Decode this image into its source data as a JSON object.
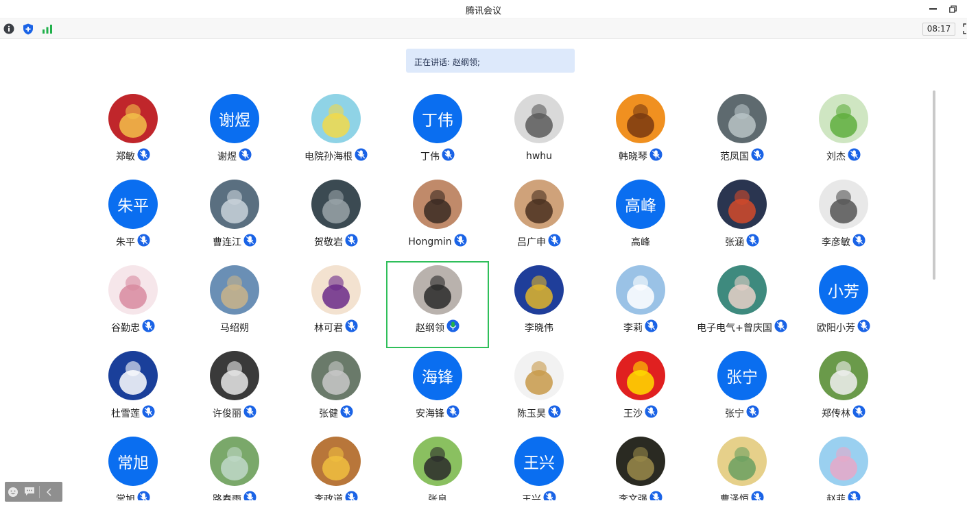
{
  "window": {
    "title": "腾讯会议"
  },
  "toolbar": {
    "timer": "08:17"
  },
  "speaking": {
    "label": "正在讲话:",
    "names": "赵纲领;"
  },
  "colors": {
    "avatar_text_bg": "#0a6ef0",
    "active_border": "#2fbf5a",
    "mic_blue": "#1a63e6",
    "mic_active": "#21b04b",
    "speaking_bg": "#dde9fb"
  },
  "participants": [
    {
      "name": "郑敏",
      "avatar": "image",
      "mic": "muted"
    },
    {
      "name": "谢煜",
      "avatar": "text",
      "avatar_text": "谢煜",
      "mic": "muted"
    },
    {
      "name": "电院孙海根",
      "avatar": "image",
      "mic": "muted"
    },
    {
      "name": "丁伟",
      "avatar": "text",
      "avatar_text": "丁伟",
      "mic": "muted"
    },
    {
      "name": "hwhu",
      "avatar": "image",
      "mic": "none"
    },
    {
      "name": "韩晓琴",
      "avatar": "image",
      "mic": "muted"
    },
    {
      "name": "范凤国",
      "avatar": "image",
      "mic": "muted"
    },
    {
      "name": "刘杰",
      "avatar": "image",
      "mic": "muted"
    },
    {
      "name": "朱平",
      "avatar": "text",
      "avatar_text": "朱平",
      "mic": "muted"
    },
    {
      "name": "曹连江",
      "avatar": "image",
      "mic": "muted"
    },
    {
      "name": "贺敬岩",
      "avatar": "image",
      "mic": "muted"
    },
    {
      "name": "Hongmin",
      "avatar": "image",
      "mic": "muted"
    },
    {
      "name": "吕广申",
      "avatar": "image",
      "mic": "muted"
    },
    {
      "name": "高峰",
      "avatar": "text",
      "avatar_text": "高峰",
      "mic": "none"
    },
    {
      "name": "张涵",
      "avatar": "image",
      "mic": "muted"
    },
    {
      "name": "李彦敏",
      "avatar": "image",
      "mic": "muted"
    },
    {
      "name": "谷勤忠",
      "avatar": "image",
      "mic": "muted"
    },
    {
      "name": "马绍朔",
      "avatar": "image",
      "mic": "none"
    },
    {
      "name": "林可君",
      "avatar": "image",
      "mic": "muted"
    },
    {
      "name": "赵纲领",
      "avatar": "image",
      "mic": "active"
    },
    {
      "name": "李晓伟",
      "avatar": "image",
      "mic": "none"
    },
    {
      "name": "李莉",
      "avatar": "image",
      "mic": "muted"
    },
    {
      "name": "电子电气+曾庆国",
      "avatar": "image",
      "mic": "muted"
    },
    {
      "name": "欧阳小芳",
      "avatar": "text",
      "avatar_text": "小芳",
      "mic": "muted"
    },
    {
      "name": "杜雪莲",
      "avatar": "image",
      "mic": "muted"
    },
    {
      "name": "许俊丽",
      "avatar": "image",
      "mic": "muted"
    },
    {
      "name": "张健",
      "avatar": "image",
      "mic": "muted"
    },
    {
      "name": "安海锋",
      "avatar": "text",
      "avatar_text": "海锋",
      "mic": "muted"
    },
    {
      "name": "陈玉昊",
      "avatar": "image",
      "mic": "muted"
    },
    {
      "name": "王沙",
      "avatar": "image",
      "mic": "muted"
    },
    {
      "name": "张宁",
      "avatar": "text",
      "avatar_text": "张宁",
      "mic": "muted"
    },
    {
      "name": "郑传林",
      "avatar": "image",
      "mic": "muted"
    },
    {
      "name": "常旭",
      "avatar": "text",
      "avatar_text": "常旭",
      "mic": "muted"
    },
    {
      "name": "路春雨",
      "avatar": "image",
      "mic": "muted"
    },
    {
      "name": "李政道",
      "avatar": "image",
      "mic": "muted"
    },
    {
      "name": "张良",
      "avatar": "image",
      "mic": "none"
    },
    {
      "name": "王兴",
      "avatar": "text",
      "avatar_text": "王兴",
      "mic": "muted"
    },
    {
      "name": "李文强",
      "avatar": "image",
      "mic": "muted"
    },
    {
      "name": "曹泽恒",
      "avatar": "image",
      "mic": "muted"
    },
    {
      "name": "赵菲",
      "avatar": "image",
      "mic": "muted"
    }
  ]
}
